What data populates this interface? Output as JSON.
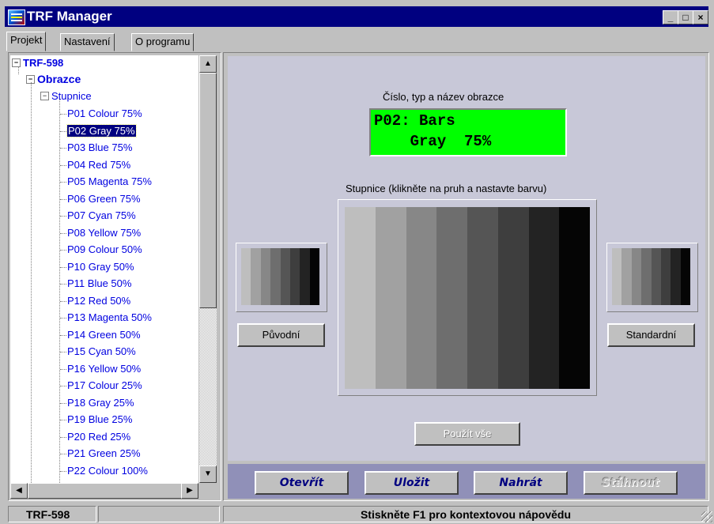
{
  "window": {
    "title": "TRF Manager"
  },
  "titlebar_buttons": {
    "minimize": "_",
    "maximize": "□",
    "close": "×"
  },
  "tabs": [
    {
      "label": "Projekt",
      "active": true
    },
    {
      "label": "Nastavení",
      "active": false
    },
    {
      "label": "O programu",
      "active": false
    }
  ],
  "tree": {
    "root": "TRF-598",
    "group": "Obrazce",
    "folder": "Stupnice",
    "items": [
      "P01 Colour 75%",
      "P02 Gray 75%",
      "P03 Blue 75%",
      "P04 Red 75%",
      "P05 Magenta 75%",
      "P06 Green 75%",
      "P07 Cyan 75%",
      "P08 Yellow 75%",
      "P09 Colour 50%",
      "P10 Gray 50%",
      "P11 Blue 50%",
      "P12 Red 50%",
      "P13 Magenta 50%",
      "P14 Green 50%",
      "P15 Cyan 50%",
      "P16 Yellow 50%",
      "P17 Colour 25%",
      "P18 Gray 25%",
      "P19 Blue 25%",
      "P20 Red 25%",
      "P21 Green 25%",
      "P22 Colour 100%"
    ],
    "selected_index": 1
  },
  "pattern": {
    "caption": "Číslo, typ a název obrazce",
    "lcd_line1": "P02: Bars",
    "lcd_line2": "    Gray  75%"
  },
  "scale": {
    "caption": "Stupnice (klikněte na pruh a nastavte barvu)",
    "bar_colors": [
      "#bebebe",
      "#a1a1a1",
      "#878787",
      "#6e6e6e",
      "#555555",
      "#3e3e3e",
      "#232323",
      "#050505"
    ],
    "original_button": "Původní",
    "standard_button": "Standardní",
    "apply_all_button": "Použít vše"
  },
  "actions": {
    "open": "Otevřít",
    "save": "Uložit",
    "upload": "Nahrát",
    "download": "Stáhnout"
  },
  "status": {
    "project": "TRF-598",
    "empty": "",
    "hint": "Stiskněte F1 pro kontextovou nápovědu"
  }
}
